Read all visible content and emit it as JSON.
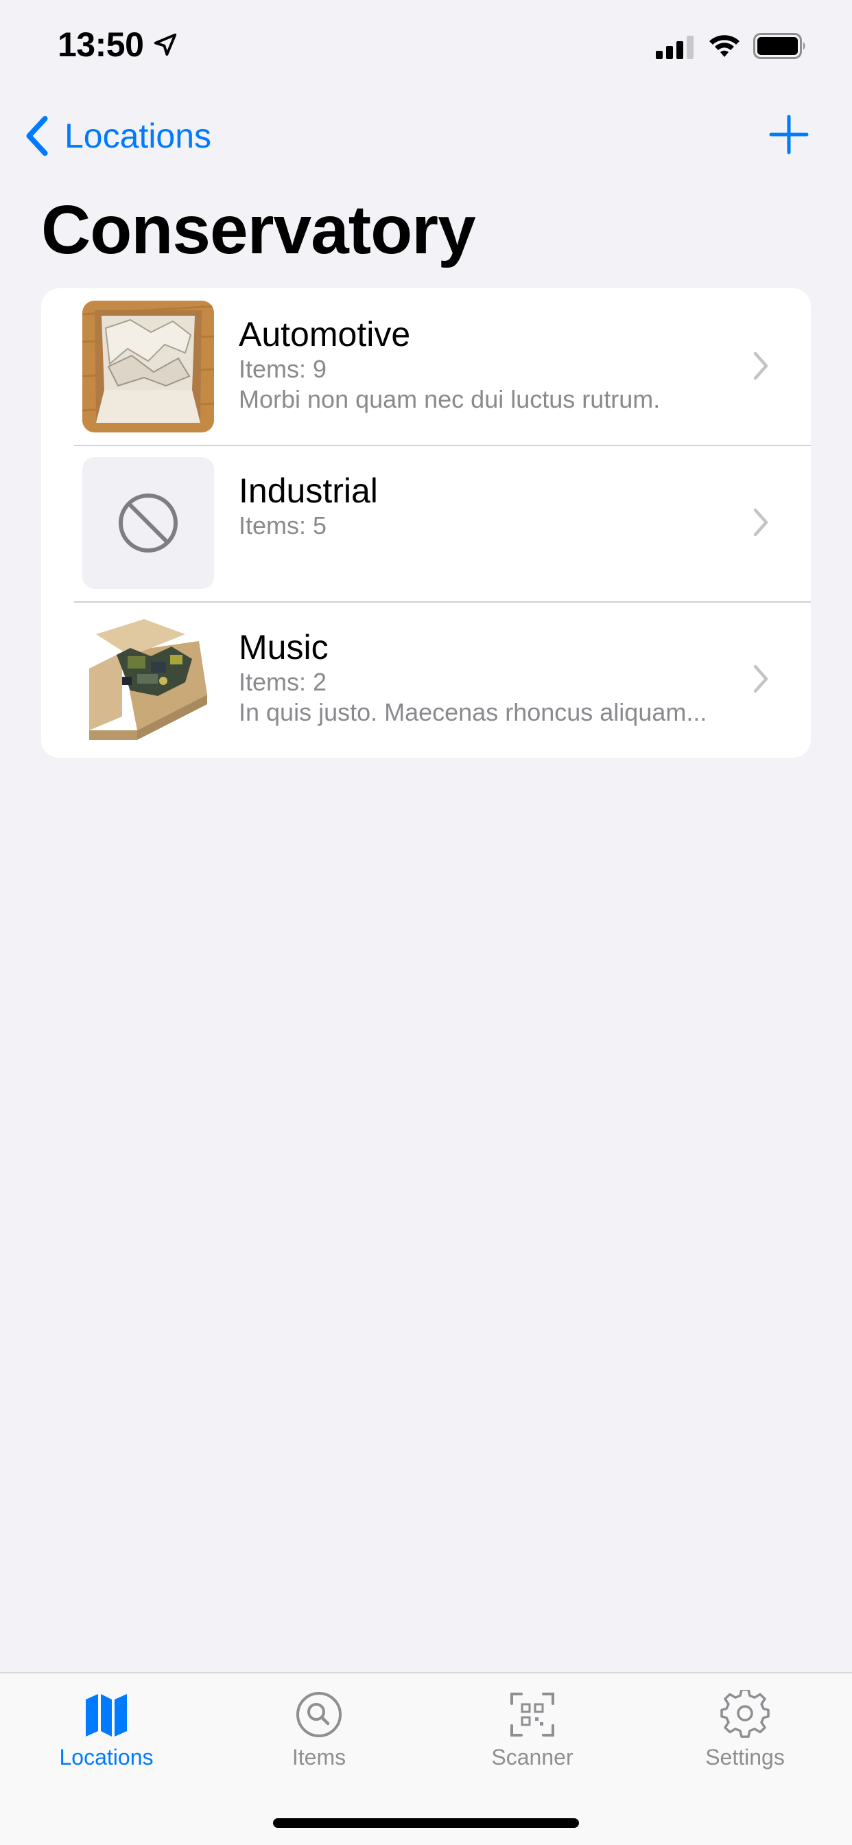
{
  "status_bar": {
    "time": "13:50",
    "icons": [
      "location-arrow-icon",
      "cellular-signal-icon",
      "wifi-icon",
      "battery-icon"
    ]
  },
  "nav": {
    "back_label": "Locations",
    "back_icon": "chevron-left-icon",
    "add_icon": "plus-icon"
  },
  "page_title": "Conservatory",
  "items": [
    {
      "title": "Automotive",
      "count": "Items: 9",
      "description": "Morbi non quam nec dui luctus rutrum.",
      "thumbnail": "cardboard-box-paper-photo"
    },
    {
      "title": "Industrial",
      "count": "Items: 5",
      "description": "",
      "thumbnail": "no-image-icon"
    },
    {
      "title": "Music",
      "count": "Items: 2",
      "description": "In quis justo. Maecenas rhoncus aliquam...",
      "thumbnail": "cardboard-box-electronics-photo"
    }
  ],
  "tabs": [
    {
      "label": "Locations",
      "icon": "map-icon",
      "active": true
    },
    {
      "label": "Items",
      "icon": "search-icon",
      "active": false
    },
    {
      "label": "Scanner",
      "icon": "qr-scanner-icon",
      "active": false
    },
    {
      "label": "Settings",
      "icon": "gear-icon",
      "active": false
    }
  ],
  "colors": {
    "accent": "#007aff",
    "background": "#f2f2f7",
    "secondary_text": "#8a8a8e",
    "tab_inactive": "#8e8e93"
  }
}
